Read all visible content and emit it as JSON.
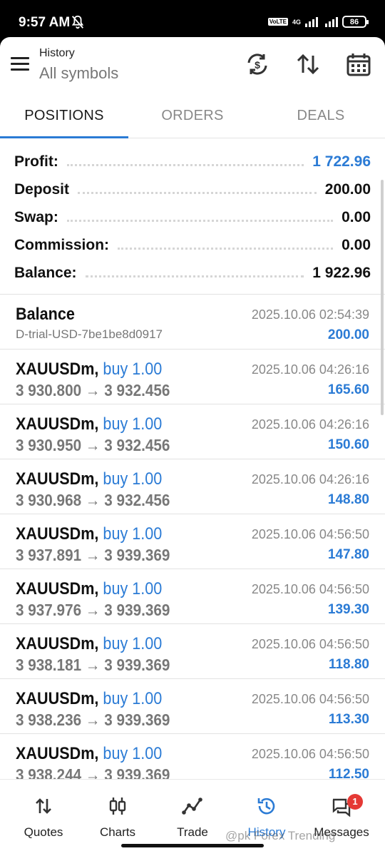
{
  "status_bar": {
    "time": "9:57 AM",
    "volte": "VoLTE",
    "network": "4G",
    "battery": "86"
  },
  "header": {
    "title": "History",
    "subtitle": "All symbols"
  },
  "tabs": [
    {
      "label": "POSITIONS",
      "active": true
    },
    {
      "label": "ORDERS",
      "active": false
    },
    {
      "label": "DEALS",
      "active": false
    }
  ],
  "summary": {
    "profit_label": "Profit:",
    "profit_value": "1 722.96",
    "deposit_label": "Deposit",
    "deposit_value": "200.00",
    "swap_label": "Swap:",
    "swap_value": "0.00",
    "commission_label": "Commission:",
    "commission_value": "0.00",
    "balance_label": "Balance:",
    "balance_value": "1 922.96"
  },
  "balance_item": {
    "title": "Balance",
    "account": "D-trial-USD-7be1be8d0917",
    "time": "2025.10.06 02:54:39",
    "amount": "200.00"
  },
  "positions": [
    {
      "symbol": "XAUUSDm,",
      "direction": "buy 1.00",
      "prices": "3 930.800 → 3 932.456",
      "time": "2025.10.06 04:26:16",
      "profit": "165.60"
    },
    {
      "symbol": "XAUUSDm,",
      "direction": "buy 1.00",
      "prices": "3 930.950 → 3 932.456",
      "time": "2025.10.06 04:26:16",
      "profit": "150.60"
    },
    {
      "symbol": "XAUUSDm,",
      "direction": "buy 1.00",
      "prices": "3 930.968 → 3 932.456",
      "time": "2025.10.06 04:26:16",
      "profit": "148.80"
    },
    {
      "symbol": "XAUUSDm,",
      "direction": "buy 1.00",
      "prices": "3 937.891 → 3 939.369",
      "time": "2025.10.06 04:56:50",
      "profit": "147.80"
    },
    {
      "symbol": "XAUUSDm,",
      "direction": "buy 1.00",
      "prices": "3 937.976 → 3 939.369",
      "time": "2025.10.06 04:56:50",
      "profit": "139.30"
    },
    {
      "symbol": "XAUUSDm,",
      "direction": "buy 1.00",
      "prices": "3 938.181 → 3 939.369",
      "time": "2025.10.06 04:56:50",
      "profit": "118.80"
    },
    {
      "symbol": "XAUUSDm,",
      "direction": "buy 1.00",
      "prices": "3 938.236 → 3 939.369",
      "time": "2025.10.06 04:56:50",
      "profit": "113.30"
    },
    {
      "symbol": "XAUUSDm,",
      "direction": "buy 1.00",
      "prices": "3 938.244 → 3 939.369",
      "time": "2025.10.06 04:56:50",
      "profit": "112.50"
    }
  ],
  "bottom_nav": [
    {
      "label": "Quotes",
      "icon": "quotes-icon"
    },
    {
      "label": "Charts",
      "icon": "charts-icon"
    },
    {
      "label": "Trade",
      "icon": "trade-icon"
    },
    {
      "label": "History",
      "icon": "history-icon",
      "active": true
    },
    {
      "label": "Messages",
      "icon": "messages-icon",
      "badge": "1"
    }
  ],
  "watermark": "@pk Forex Trending",
  "colors": {
    "accent": "#2b7bd5",
    "badge": "#e53935"
  }
}
